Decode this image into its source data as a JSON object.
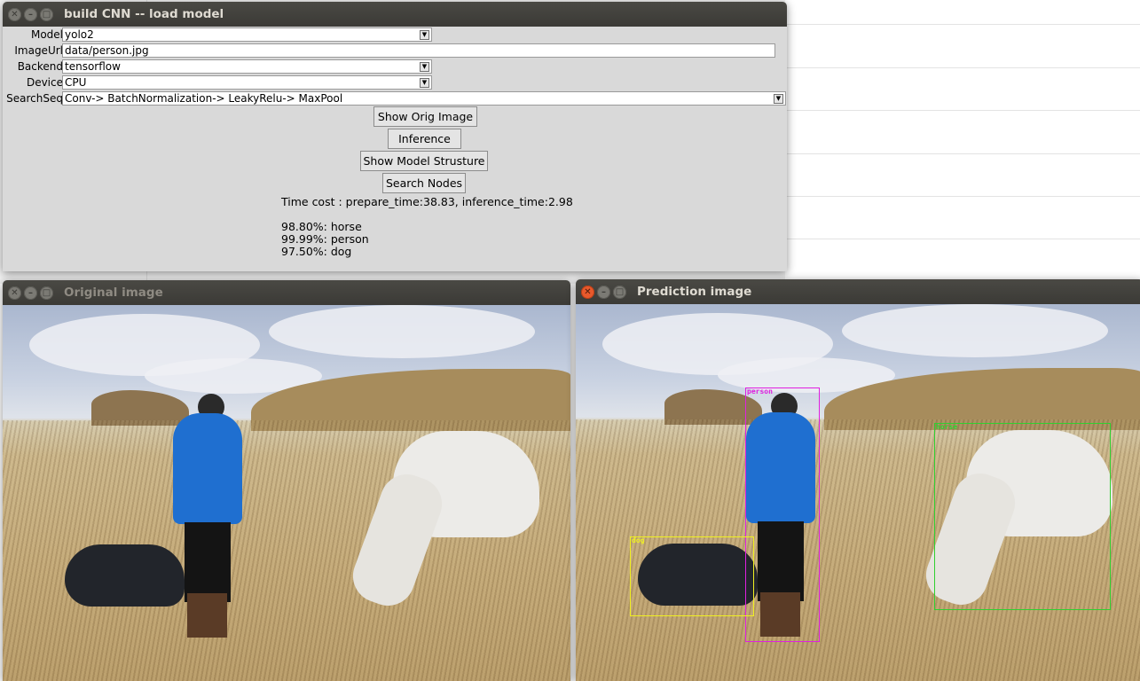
{
  "control_window": {
    "title": "build CNN -- load model",
    "fields": {
      "model": {
        "label": "Model",
        "value": "yolo2"
      },
      "image_url": {
        "label": "ImageUrl",
        "value": "data/person.jpg"
      },
      "backend": {
        "label": "Backend",
        "value": "tensorflow"
      },
      "device": {
        "label": "Device",
        "value": "CPU"
      },
      "search_seq": {
        "label": "SearchSeq",
        "value": "Conv-> BatchNormalization-> LeakyRelu-> MaxPool"
      }
    },
    "buttons": {
      "show_orig": "Show Orig Image",
      "inference": "Inference",
      "show_model": "Show Model Strusture",
      "search_nodes": "Search Nodes"
    },
    "time_cost": "Time cost : prepare_time:38.83, inference_time:2.98",
    "results": [
      "98.80%: horse",
      "99.99%: person",
      "97.50%: dog"
    ]
  },
  "original_window": {
    "title": "Original image"
  },
  "prediction_window": {
    "title": "Prediction image",
    "detections": [
      {
        "label": "person",
        "color": "#e020e0"
      },
      {
        "label": "horse",
        "color": "#30d030"
      },
      {
        "label": "dog",
        "color": "#f0f020"
      }
    ]
  },
  "colors": {
    "titlebar": "#3c3b37",
    "window_bg": "#d9d9d9",
    "close_button": "#e8592c"
  }
}
